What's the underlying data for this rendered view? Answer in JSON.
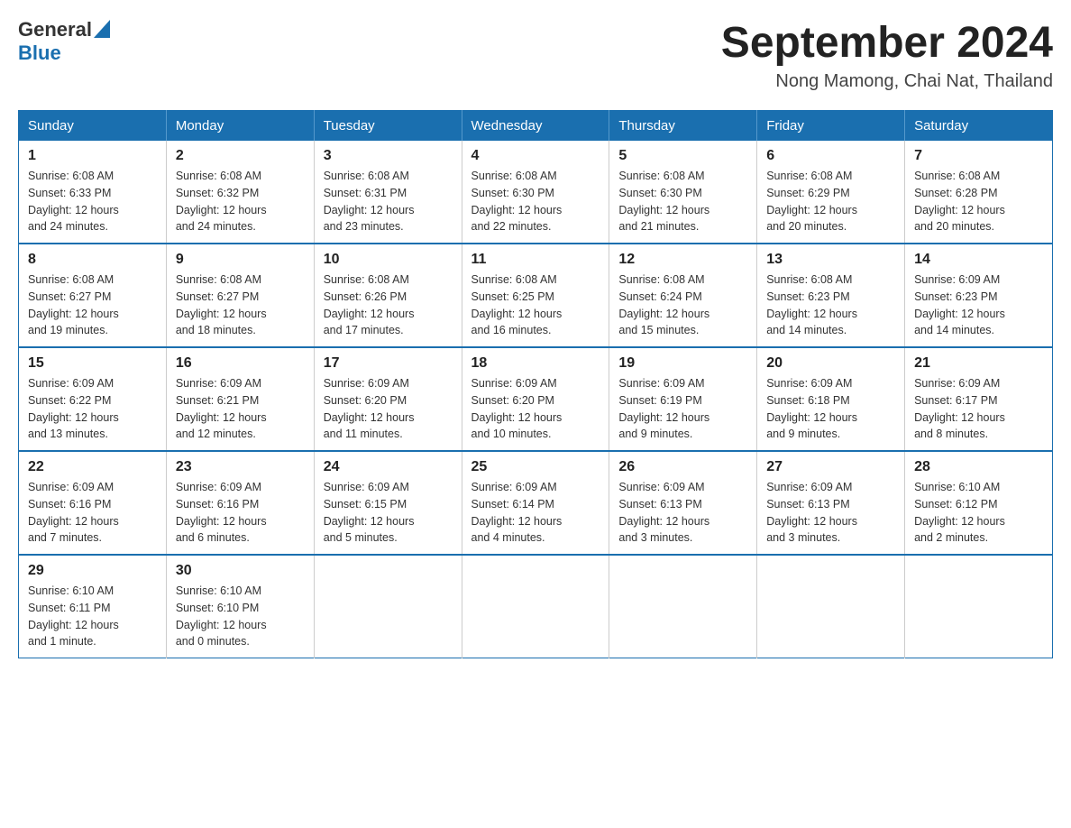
{
  "header": {
    "logo_general": "General",
    "logo_blue": "Blue",
    "title": "September 2024",
    "subtitle": "Nong Mamong, Chai Nat, Thailand"
  },
  "weekdays": [
    "Sunday",
    "Monday",
    "Tuesday",
    "Wednesday",
    "Thursday",
    "Friday",
    "Saturday"
  ],
  "weeks": [
    [
      {
        "day": "1",
        "sunrise": "6:08 AM",
        "sunset": "6:33 PM",
        "daylight": "12 hours and 24 minutes."
      },
      {
        "day": "2",
        "sunrise": "6:08 AM",
        "sunset": "6:32 PM",
        "daylight": "12 hours and 24 minutes."
      },
      {
        "day": "3",
        "sunrise": "6:08 AM",
        "sunset": "6:31 PM",
        "daylight": "12 hours and 23 minutes."
      },
      {
        "day": "4",
        "sunrise": "6:08 AM",
        "sunset": "6:30 PM",
        "daylight": "12 hours and 22 minutes."
      },
      {
        "day": "5",
        "sunrise": "6:08 AM",
        "sunset": "6:30 PM",
        "daylight": "12 hours and 21 minutes."
      },
      {
        "day": "6",
        "sunrise": "6:08 AM",
        "sunset": "6:29 PM",
        "daylight": "12 hours and 20 minutes."
      },
      {
        "day": "7",
        "sunrise": "6:08 AM",
        "sunset": "6:28 PM",
        "daylight": "12 hours and 20 minutes."
      }
    ],
    [
      {
        "day": "8",
        "sunrise": "6:08 AM",
        "sunset": "6:27 PM",
        "daylight": "12 hours and 19 minutes."
      },
      {
        "day": "9",
        "sunrise": "6:08 AM",
        "sunset": "6:27 PM",
        "daylight": "12 hours and 18 minutes."
      },
      {
        "day": "10",
        "sunrise": "6:08 AM",
        "sunset": "6:26 PM",
        "daylight": "12 hours and 17 minutes."
      },
      {
        "day": "11",
        "sunrise": "6:08 AM",
        "sunset": "6:25 PM",
        "daylight": "12 hours and 16 minutes."
      },
      {
        "day": "12",
        "sunrise": "6:08 AM",
        "sunset": "6:24 PM",
        "daylight": "12 hours and 15 minutes."
      },
      {
        "day": "13",
        "sunrise": "6:08 AM",
        "sunset": "6:23 PM",
        "daylight": "12 hours and 14 minutes."
      },
      {
        "day": "14",
        "sunrise": "6:09 AM",
        "sunset": "6:23 PM",
        "daylight": "12 hours and 14 minutes."
      }
    ],
    [
      {
        "day": "15",
        "sunrise": "6:09 AM",
        "sunset": "6:22 PM",
        "daylight": "12 hours and 13 minutes."
      },
      {
        "day": "16",
        "sunrise": "6:09 AM",
        "sunset": "6:21 PM",
        "daylight": "12 hours and 12 minutes."
      },
      {
        "day": "17",
        "sunrise": "6:09 AM",
        "sunset": "6:20 PM",
        "daylight": "12 hours and 11 minutes."
      },
      {
        "day": "18",
        "sunrise": "6:09 AM",
        "sunset": "6:20 PM",
        "daylight": "12 hours and 10 minutes."
      },
      {
        "day": "19",
        "sunrise": "6:09 AM",
        "sunset": "6:19 PM",
        "daylight": "12 hours and 9 minutes."
      },
      {
        "day": "20",
        "sunrise": "6:09 AM",
        "sunset": "6:18 PM",
        "daylight": "12 hours and 9 minutes."
      },
      {
        "day": "21",
        "sunrise": "6:09 AM",
        "sunset": "6:17 PM",
        "daylight": "12 hours and 8 minutes."
      }
    ],
    [
      {
        "day": "22",
        "sunrise": "6:09 AM",
        "sunset": "6:16 PM",
        "daylight": "12 hours and 7 minutes."
      },
      {
        "day": "23",
        "sunrise": "6:09 AM",
        "sunset": "6:16 PM",
        "daylight": "12 hours and 6 minutes."
      },
      {
        "day": "24",
        "sunrise": "6:09 AM",
        "sunset": "6:15 PM",
        "daylight": "12 hours and 5 minutes."
      },
      {
        "day": "25",
        "sunrise": "6:09 AM",
        "sunset": "6:14 PM",
        "daylight": "12 hours and 4 minutes."
      },
      {
        "day": "26",
        "sunrise": "6:09 AM",
        "sunset": "6:13 PM",
        "daylight": "12 hours and 3 minutes."
      },
      {
        "day": "27",
        "sunrise": "6:09 AM",
        "sunset": "6:13 PM",
        "daylight": "12 hours and 3 minutes."
      },
      {
        "day": "28",
        "sunrise": "6:10 AM",
        "sunset": "6:12 PM",
        "daylight": "12 hours and 2 minutes."
      }
    ],
    [
      {
        "day": "29",
        "sunrise": "6:10 AM",
        "sunset": "6:11 PM",
        "daylight": "12 hours and 1 minute."
      },
      {
        "day": "30",
        "sunrise": "6:10 AM",
        "sunset": "6:10 PM",
        "daylight": "12 hours and 0 minutes."
      },
      null,
      null,
      null,
      null,
      null
    ]
  ],
  "labels": {
    "sunrise": "Sunrise:",
    "sunset": "Sunset:",
    "daylight": "Daylight:"
  }
}
